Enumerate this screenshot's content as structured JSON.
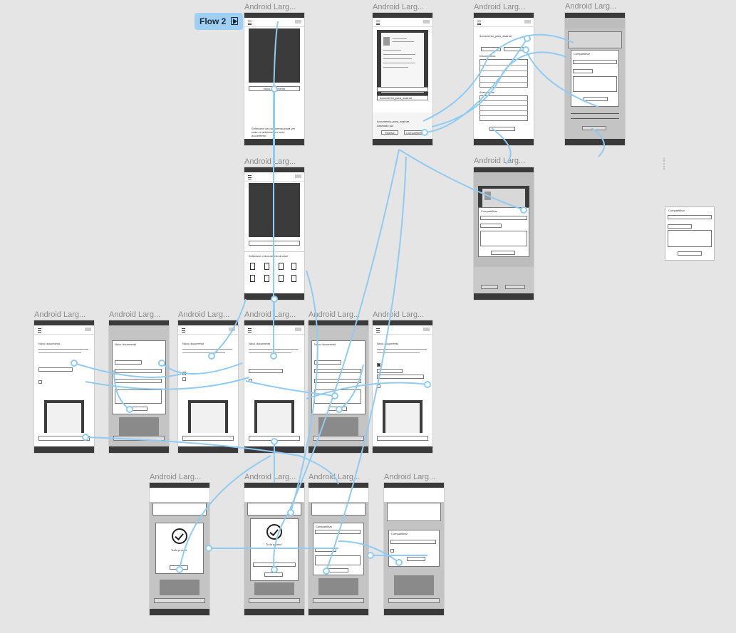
{
  "flow_badge": {
    "label": "Flow 2",
    "icon": "play-frame-icon"
  },
  "frame_label": "Android Larg...",
  "screens": {
    "home_empty": {
      "button": "Novo documento",
      "hint": "Selecione um documento para ver mais ou adicione um novo documento."
    },
    "file_picker": {
      "button": "Novo documento",
      "hint": "Selecione o documento a colar"
    },
    "doc_view": {
      "filename": "documento_para_assinar",
      "sign_label": "Assinado por",
      "reject": "Rejeitar",
      "sign": "Compartilhar"
    },
    "signature_list": {
      "title": "documento_para_assinar",
      "tab_left": "Assinar",
      "tab_right": "Compartilhar",
      "section1": "Documentos",
      "section2": "Assinaturas",
      "row": "Nome do ativo",
      "footer_btn": "Adicionar documento"
    },
    "share_modal": {
      "title": "Compartilhar",
      "placeholder": "Enviar link de compartilhamento",
      "link": "www.link.com.br/shared",
      "role": "Tipo de compartilhamento",
      "send": "Enviar por e-mail"
    },
    "new_doc": {
      "title": "Novo documento",
      "desc": "Você pode adicionar participantes manualmente ou compartilhar o documento para qualquer pessoa assinar.",
      "checkbox_auto": "Auto-assinar meu documento",
      "checkbox_permit": "Permitir que os assinantes vejam relatórios",
      "participants": "Adicionar participante",
      "name": "Nome",
      "email": "E-mail",
      "role": "Papel do ativo",
      "comment": "Comentário do assinante",
      "save": "Salvar",
      "cancel": "Cancelar"
    },
    "success": {
      "title": "Tudo pronto!",
      "desc": "Verifique o progresso do documento na página inicial.",
      "ok": "Ok"
    }
  }
}
